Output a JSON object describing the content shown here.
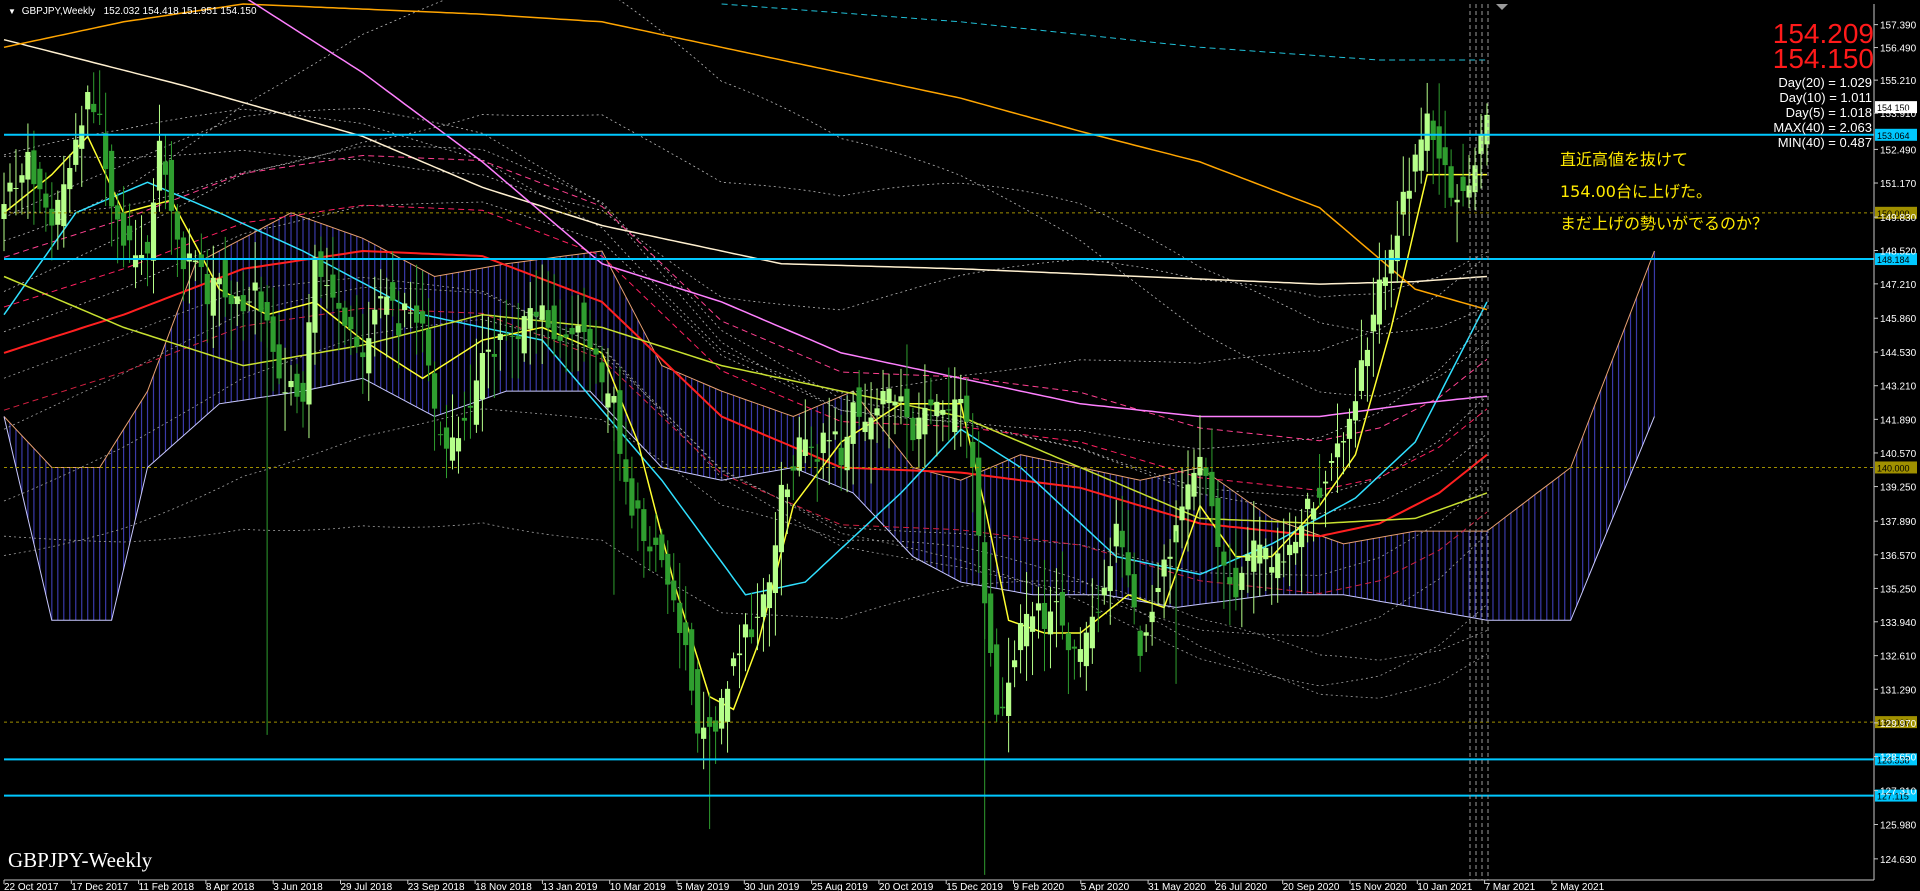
{
  "chart_header": {
    "symbol": "GBPJPY,Weekly",
    "ohlc": "152.032 154.418 151.951 154.150"
  },
  "watermark": "GBPJPY-Weekly",
  "big_prices": [
    "154.209",
    "154.150"
  ],
  "stats": [
    "Day(20) = 1.029",
    "Day(10) = 1.011",
    "Day(5) = 1.018",
    "MAX(40) = 2.063",
    "MIN(40) = 0.487"
  ],
  "annotation": [
    "直近高値を抜けて",
    "154.00台に上げた。",
    "まだ上げの勢いがでるのか？"
  ],
  "colors": {
    "background": "#000000",
    "bull": "#b6ff8a",
    "bear": "#2f9e2f",
    "hline": "#00c8ff",
    "ma_red": "#ff2020",
    "ma_cyan": "#30e0ff",
    "ma_yellow": "#ffff30",
    "ma_olive": "#c8e030",
    "ma_orange": "#ffa500",
    "ma_pink": "#ff80ff",
    "ma_cream": "#fff0d0",
    "stats_text": "#ffffff",
    "price_big": "#ff1a1a",
    "annotation": "#ffea00"
  },
  "chart_data": {
    "type": "candlestick",
    "symbol": "GBPJPY",
    "timeframe": "Weekly",
    "ylim": [
      123.8,
      158.2
    ],
    "y_ticks": [
      "157.390",
      "156.490",
      "155.210",
      "153.910",
      "152.490",
      "151.170",
      "149.830",
      "148.520",
      "147.210",
      "145.860",
      "144.530",
      "143.210",
      "141.890",
      "140.570",
      "139.250",
      "137.890",
      "136.570",
      "135.250",
      "133.940",
      "132.610",
      "131.290",
      "129.970",
      "128.650",
      "127.310",
      "125.980",
      "124.630"
    ],
    "x_labels": [
      "22 Oct 2017",
      "17 Dec 2017",
      "11 Feb 2018",
      "8 Apr 2018",
      "3 Jun 2018",
      "29 Jul 2018",
      "23 Sep 2018",
      "18 Nov 2018",
      "13 Jan 2019",
      "10 Mar 2019",
      "5 May 2019",
      "30 Jun 2019",
      "25 Aug 2019",
      "20 Oct 2019",
      "15 Dec 2019",
      "9 Feb 2020",
      "5 Apr 2020",
      "31 May 2020",
      "26 Jul 2020",
      "20 Sep 2020",
      "15 Nov 2020",
      "10 Jan 2021",
      "7 Mar 2021",
      "2 May 2021"
    ],
    "current_price": 154.15,
    "horizontal_levels": [
      {
        "price": 153.064,
        "label": "153.064",
        "color": "#00c8ff"
      },
      {
        "price": 150.0,
        "label": "150.000",
        "color": "#a09000"
      },
      {
        "price": 148.184,
        "label": "148.184",
        "color": "#00c8ff"
      },
      {
        "price": 140.0,
        "label": "140.000",
        "color": "#a09000"
      },
      {
        "price": 130.0,
        "label": "130.000",
        "color": "#a09000"
      },
      {
        "price": 128.538,
        "label": "128.538",
        "color": "#00c8ff"
      },
      {
        "price": 127.115,
        "label": "127.115",
        "color": "#00c8ff"
      }
    ],
    "close_path": [
      [
        0,
        150.5
      ],
      [
        4,
        152.0
      ],
      [
        8,
        149.5
      ],
      [
        10,
        150.8
      ],
      [
        14,
        154.5
      ],
      [
        16,
        153.5
      ],
      [
        18,
        150.0
      ],
      [
        22,
        148.0
      ],
      [
        24,
        148.5
      ],
      [
        26,
        152.5
      ],
      [
        28,
        150.5
      ],
      [
        30,
        148.0
      ],
      [
        32,
        148.5
      ],
      [
        34,
        146.5
      ],
      [
        36,
        147.5
      ],
      [
        40,
        146.0
      ],
      [
        42,
        147.5
      ],
      [
        46,
        143.5
      ],
      [
        50,
        142.5
      ],
      [
        52,
        148.5
      ],
      [
        54,
        147.0
      ],
      [
        56,
        146.5
      ],
      [
        58,
        145.0
      ],
      [
        60,
        144.0
      ],
      [
        62,
        146.0
      ],
      [
        64,
        147.0
      ],
      [
        66,
        145.5
      ],
      [
        68,
        146.5
      ],
      [
        70,
        145.5
      ],
      [
        72,
        142.0
      ],
      [
        74,
        140.5
      ],
      [
        76,
        141.5
      ],
      [
        78,
        142.0
      ],
      [
        80,
        144.5
      ],
      [
        84,
        145.0
      ],
      [
        86,
        145.0
      ],
      [
        88,
        146.0
      ],
      [
        90,
        146.5
      ],
      [
        92,
        145.0
      ],
      [
        94,
        145.0
      ],
      [
        96,
        146.0
      ],
      [
        98,
        145.0
      ],
      [
        100,
        143.0
      ],
      [
        102,
        142.5
      ],
      [
        104,
        139.0
      ],
      [
        106,
        138.0
      ],
      [
        108,
        137.0
      ],
      [
        110,
        136.5
      ],
      [
        112,
        134.5
      ],
      [
        114,
        133.0
      ],
      [
        116,
        130.0
      ],
      [
        118,
        129.5
      ],
      [
        120,
        130.5
      ],
      [
        122,
        132.5
      ],
      [
        124,
        133.5
      ],
      [
        126,
        134.0
      ],
      [
        128,
        135.5
      ],
      [
        130,
        139.0
      ],
      [
        132,
        140.0
      ],
      [
        134,
        141.5
      ],
      [
        136,
        140.5
      ],
      [
        138,
        141.5
      ],
      [
        140,
        140.5
      ],
      [
        142,
        142.5
      ],
      [
        144,
        141.5
      ],
      [
        146,
        142.5
      ],
      [
        148,
        143.0
      ],
      [
        150,
        142.5
      ],
      [
        152,
        141.5
      ],
      [
        154,
        142.0
      ],
      [
        156,
        142.5
      ],
      [
        158,
        142.0
      ],
      [
        160,
        143.0
      ],
      [
        162,
        140.0
      ],
      [
        164,
        135.0
      ],
      [
        166,
        130.0
      ],
      [
        168,
        131.5
      ],
      [
        170,
        133.5
      ],
      [
        172,
        134.5
      ],
      [
        174,
        134.0
      ],
      [
        176,
        134.5
      ],
      [
        178,
        133.0
      ],
      [
        180,
        132.5
      ],
      [
        182,
        134.0
      ],
      [
        184,
        135.5
      ],
      [
        186,
        137.5
      ],
      [
        188,
        135.5
      ],
      [
        190,
        133.0
      ],
      [
        192,
        134.5
      ],
      [
        194,
        136.0
      ],
      [
        196,
        137.5
      ],
      [
        198,
        139.0
      ],
      [
        200,
        140.0
      ],
      [
        202,
        138.5
      ],
      [
        204,
        136.0
      ],
      [
        206,
        135.0
      ],
      [
        208,
        136.5
      ],
      [
        210,
        137.0
      ],
      [
        212,
        136.0
      ],
      [
        214,
        136.5
      ],
      [
        216,
        137.0
      ],
      [
        218,
        138.5
      ],
      [
        220,
        139.0
      ],
      [
        222,
        140.0
      ],
      [
        224,
        141.0
      ],
      [
        226,
        143.0
      ],
      [
        228,
        145.0
      ],
      [
        230,
        147.0
      ],
      [
        232,
        148.5
      ],
      [
        234,
        150.5
      ],
      [
        236,
        152.0
      ],
      [
        238,
        153.5
      ],
      [
        240,
        152.0
      ],
      [
        242,
        151.0
      ],
      [
        244,
        150.5
      ],
      [
        246,
        152.0
      ],
      [
        248,
        154.15
      ]
    ],
    "moving_averages": [
      {
        "key": "red",
        "color": "#ff2020",
        "width": 2,
        "points": [
          [
            0,
            144.5
          ],
          [
            20,
            146.0
          ],
          [
            40,
            147.8
          ],
          [
            60,
            148.5
          ],
          [
            80,
            148.3
          ],
          [
            100,
            146.5
          ],
          [
            120,
            142.0
          ],
          [
            140,
            140.0
          ],
          [
            160,
            139.8
          ],
          [
            180,
            139.2
          ],
          [
            200,
            137.8
          ],
          [
            220,
            137.3
          ],
          [
            230,
            137.8
          ],
          [
            240,
            139.0
          ],
          [
            248,
            140.5
          ]
        ]
      },
      {
        "key": "cyan",
        "color": "#30e0ff",
        "width": 1.5,
        "points": [
          [
            0,
            146.0
          ],
          [
            12,
            150.0
          ],
          [
            24,
            151.2
          ],
          [
            36,
            150.0
          ],
          [
            50,
            148.5
          ],
          [
            70,
            146.0
          ],
          [
            90,
            145.0
          ],
          [
            110,
            139.5
          ],
          [
            124,
            135.0
          ],
          [
            134,
            135.5
          ],
          [
            150,
            139.0
          ],
          [
            160,
            141.5
          ],
          [
            170,
            140.0
          ],
          [
            186,
            136.5
          ],
          [
            200,
            135.8
          ],
          [
            212,
            137.0
          ],
          [
            226,
            138.8
          ],
          [
            236,
            141.0
          ],
          [
            248,
            146.5
          ]
        ]
      },
      {
        "key": "olive",
        "color": "#c8e030",
        "width": 1.5,
        "points": [
          [
            0,
            147.5
          ],
          [
            20,
            145.5
          ],
          [
            40,
            144.0
          ],
          [
            60,
            144.8
          ],
          [
            80,
            146.0
          ],
          [
            100,
            145.5
          ],
          [
            120,
            144.0
          ],
          [
            140,
            143.0
          ],
          [
            160,
            142.0
          ],
          [
            180,
            140.0
          ],
          [
            200,
            138.0
          ],
          [
            220,
            137.8
          ],
          [
            236,
            138.0
          ],
          [
            248,
            139.0
          ]
        ]
      },
      {
        "key": "yellow",
        "color": "#ffff30",
        "width": 1.5,
        "points": [
          [
            0,
            150.0
          ],
          [
            8,
            151.5
          ],
          [
            14,
            153.0
          ],
          [
            20,
            150.0
          ],
          [
            28,
            150.5
          ],
          [
            36,
            147.0
          ],
          [
            44,
            146.0
          ],
          [
            52,
            146.5
          ],
          [
            60,
            145.0
          ],
          [
            70,
            143.5
          ],
          [
            80,
            145.0
          ],
          [
            90,
            145.5
          ],
          [
            100,
            144.5
          ],
          [
            106,
            141.0
          ],
          [
            112,
            135.5
          ],
          [
            118,
            131.0
          ],
          [
            122,
            130.5
          ],
          [
            126,
            133.0
          ],
          [
            132,
            138.5
          ],
          [
            140,
            141.0
          ],
          [
            150,
            142.5
          ],
          [
            160,
            142.5
          ],
          [
            164,
            138.5
          ],
          [
            168,
            134.0
          ],
          [
            174,
            133.5
          ],
          [
            180,
            133.5
          ],
          [
            188,
            135.0
          ],
          [
            194,
            134.5
          ],
          [
            200,
            138.5
          ],
          [
            206,
            136.5
          ],
          [
            212,
            136.5
          ],
          [
            220,
            138.5
          ],
          [
            226,
            140.5
          ],
          [
            232,
            145.5
          ],
          [
            238,
            151.5
          ],
          [
            242,
            151.5
          ],
          [
            248,
            151.5
          ]
        ]
      },
      {
        "key": "cream",
        "color": "#fff0d0",
        "width": 1.5,
        "points": [
          [
            0,
            156.8
          ],
          [
            30,
            155.0
          ],
          [
            60,
            153.0
          ],
          [
            80,
            151.0
          ],
          [
            100,
            149.5
          ],
          [
            130,
            148.0
          ],
          [
            160,
            147.8
          ],
          [
            190,
            147.5
          ],
          [
            220,
            147.2
          ],
          [
            236,
            147.3
          ],
          [
            248,
            147.5
          ]
        ]
      },
      {
        "key": "orange",
        "color": "#ffa500",
        "width": 1.5,
        "points": [
          [
            0,
            156.5
          ],
          [
            20,
            157.5
          ],
          [
            40,
            158.2
          ],
          [
            60,
            158.0
          ],
          [
            80,
            157.8
          ],
          [
            100,
            157.5
          ],
          [
            120,
            156.5
          ],
          [
            140,
            155.5
          ],
          [
            160,
            154.5
          ],
          [
            180,
            153.2
          ],
          [
            200,
            152.0
          ],
          [
            220,
            150.2
          ],
          [
            236,
            147.0
          ],
          [
            248,
            146.2
          ]
        ]
      },
      {
        "key": "pink",
        "color": "#ff80ff",
        "width": 1.5,
        "points": [
          [
            40,
            158.5
          ],
          [
            60,
            155.5
          ],
          [
            80,
            152.0
          ],
          [
            100,
            148.0
          ],
          [
            120,
            146.5
          ],
          [
            140,
            144.5
          ],
          [
            160,
            143.5
          ],
          [
            180,
            142.5
          ],
          [
            200,
            142.0
          ],
          [
            220,
            142.0
          ],
          [
            236,
            142.5
          ],
          [
            248,
            142.8
          ]
        ]
      },
      {
        "key": "teal-dashed",
        "color": "#20c0d8",
        "width": 1,
        "dash": "6,4",
        "points": [
          [
            120,
            158.2
          ],
          [
            160,
            157.5
          ],
          [
            200,
            156.5
          ],
          [
            230,
            156.0
          ],
          [
            248,
            156.0
          ]
        ]
      }
    ],
    "ichimoku_cloud": {
      "upper": [
        [
          0,
          142.0
        ],
        [
          8,
          140.0
        ],
        [
          16,
          140.0
        ],
        [
          24,
          143.0
        ],
        [
          32,
          148.0
        ],
        [
          48,
          150.0
        ],
        [
          60,
          149.0
        ],
        [
          72,
          147.5
        ],
        [
          84,
          148.0
        ],
        [
          100,
          148.5
        ],
        [
          110,
          144.0
        ],
        [
          120,
          143.0
        ],
        [
          132,
          142.0
        ],
        [
          142,
          143.0
        ],
        [
          152,
          140.0
        ],
        [
          160,
          139.5
        ],
        [
          170,
          140.5
        ],
        [
          180,
          140.0
        ],
        [
          190,
          139.5
        ],
        [
          200,
          140.0
        ],
        [
          212,
          138.0
        ],
        [
          224,
          137.0
        ],
        [
          236,
          137.5
        ],
        [
          248,
          137.5
        ],
        [
          262,
          140.0
        ],
        [
          276,
          148.5
        ]
      ],
      "lower": [
        [
          0,
          142.0
        ],
        [
          8,
          134.0
        ],
        [
          18,
          134.0
        ],
        [
          24,
          140.0
        ],
        [
          36,
          142.5
        ],
        [
          50,
          143.0
        ],
        [
          60,
          143.5
        ],
        [
          72,
          142.0
        ],
        [
          84,
          143.0
        ],
        [
          98,
          143.0
        ],
        [
          110,
          140.0
        ],
        [
          120,
          139.5
        ],
        [
          132,
          140.0
        ],
        [
          142,
          139.0
        ],
        [
          152,
          136.5
        ],
        [
          160,
          135.5
        ],
        [
          172,
          135.0
        ],
        [
          184,
          135.0
        ],
        [
          196,
          134.5
        ],
        [
          212,
          135.0
        ],
        [
          224,
          135.0
        ],
        [
          236,
          134.5
        ],
        [
          248,
          134.0
        ],
        [
          262,
          134.0
        ],
        [
          276,
          142.0
        ]
      ]
    }
  }
}
